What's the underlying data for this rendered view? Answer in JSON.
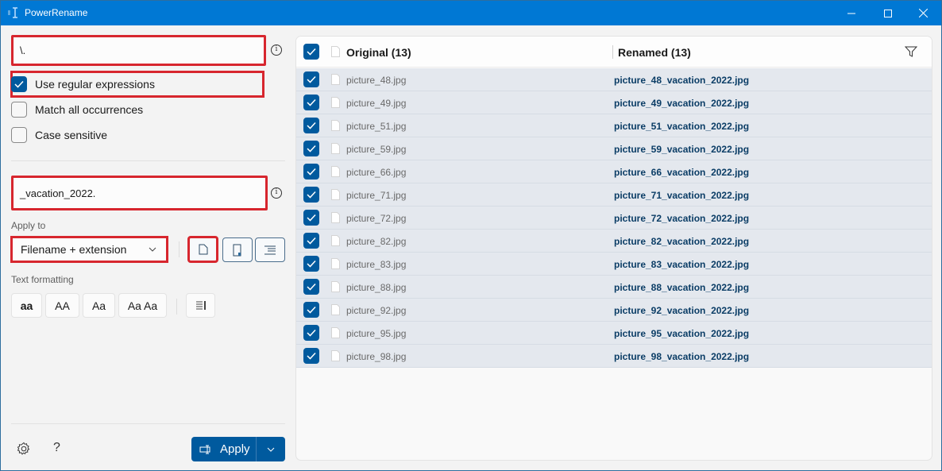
{
  "window": {
    "title": "PowerRename",
    "controls": {
      "minimize": "minimize",
      "maximize": "maximize",
      "close": "close"
    }
  },
  "search": {
    "value": "\\.",
    "info_icon": "info-icon"
  },
  "options": [
    {
      "label": "Use regular expressions",
      "checked": true
    },
    {
      "label": "Match all occurrences",
      "checked": false
    },
    {
      "label": "Case sensitive",
      "checked": false
    }
  ],
  "replace": {
    "value": "_vacation_2022."
  },
  "apply_to": {
    "label": "Apply to",
    "selected": "Filename + extension"
  },
  "text_formatting": {
    "label": "Text formatting",
    "buttons": [
      "aa",
      "AA",
      "Aa",
      "Aa Aa"
    ]
  },
  "footer": {
    "apply_label": "Apply"
  },
  "list": {
    "original_header": "Original (13)",
    "renamed_header": "Renamed (13)",
    "rows": [
      {
        "original": "picture_48.jpg",
        "renamed": "picture_48_vacation_2022.jpg"
      },
      {
        "original": "picture_49.jpg",
        "renamed": "picture_49_vacation_2022.jpg"
      },
      {
        "original": "picture_51.jpg",
        "renamed": "picture_51_vacation_2022.jpg"
      },
      {
        "original": "picture_59.jpg",
        "renamed": "picture_59_vacation_2022.jpg"
      },
      {
        "original": "picture_66.jpg",
        "renamed": "picture_66_vacation_2022.jpg"
      },
      {
        "original": "picture_71.jpg",
        "renamed": "picture_71_vacation_2022.jpg"
      },
      {
        "original": "picture_72.jpg",
        "renamed": "picture_72_vacation_2022.jpg"
      },
      {
        "original": "picture_82.jpg",
        "renamed": "picture_82_vacation_2022.jpg"
      },
      {
        "original": "picture_83.jpg",
        "renamed": "picture_83_vacation_2022.jpg"
      },
      {
        "original": "picture_88.jpg",
        "renamed": "picture_88_vacation_2022.jpg"
      },
      {
        "original": "picture_92.jpg",
        "renamed": "picture_92_vacation_2022.jpg"
      },
      {
        "original": "picture_95.jpg",
        "renamed": "picture_95_vacation_2022.jpg"
      },
      {
        "original": "picture_98.jpg",
        "renamed": "picture_98_vacation_2022.jpg"
      }
    ]
  },
  "colors": {
    "titlebar": "#0078d4",
    "accent": "#005a9e",
    "highlight": "#d7262e",
    "renamed_text": "#0b3d66"
  }
}
